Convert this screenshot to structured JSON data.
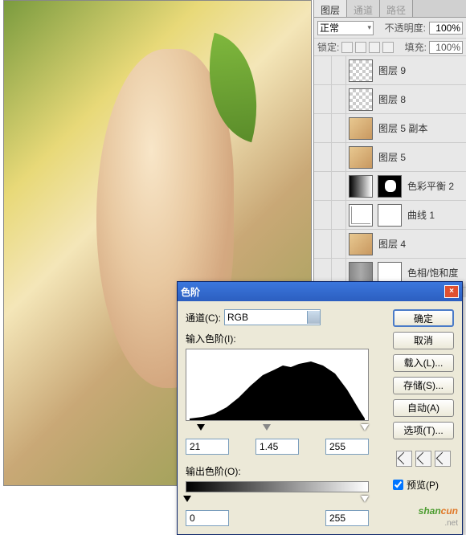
{
  "tabs": {
    "layers": "图层",
    "channels": "通道",
    "paths": "路径"
  },
  "blend": {
    "mode": "正常",
    "opacity_label": "不透明度:",
    "opacity": "100%",
    "lock_label": "锁定:",
    "fill_label": "填充:",
    "fill": "100%"
  },
  "layers": [
    {
      "name": "图层 9",
      "thumb": "checker"
    },
    {
      "name": "图层 8",
      "thumb": "checker"
    },
    {
      "name": "图层 5 副本",
      "thumb": "img"
    },
    {
      "name": "图层 5",
      "thumb": "img"
    },
    {
      "name": "色彩平衡 2",
      "thumb": "adj",
      "mask": "maskb"
    },
    {
      "name": "曲线 1",
      "thumb": "curves",
      "mask": "mask"
    },
    {
      "name": "图层 4",
      "thumb": "img"
    },
    {
      "name": "色相/饱和度",
      "thumb": "hue",
      "mask": "mask"
    }
  ],
  "dialog": {
    "title": "色阶",
    "channel_label": "通道(C):",
    "channel": "RGB",
    "input_label": "输入色阶(I):",
    "output_label": "输出色阶(O):",
    "in_black": "21",
    "in_gamma": "1.45",
    "in_white": "255",
    "out_black": "0",
    "out_white": "255",
    "buttons": {
      "ok": "确定",
      "cancel": "取消",
      "load": "载入(L)...",
      "save": "存储(S)...",
      "auto": "自动(A)",
      "options": "选项(T)..."
    },
    "preview": "预览(P)"
  },
  "watermark": {
    "text1": "shan",
    "text2": "cun",
    "sub": ".net"
  }
}
